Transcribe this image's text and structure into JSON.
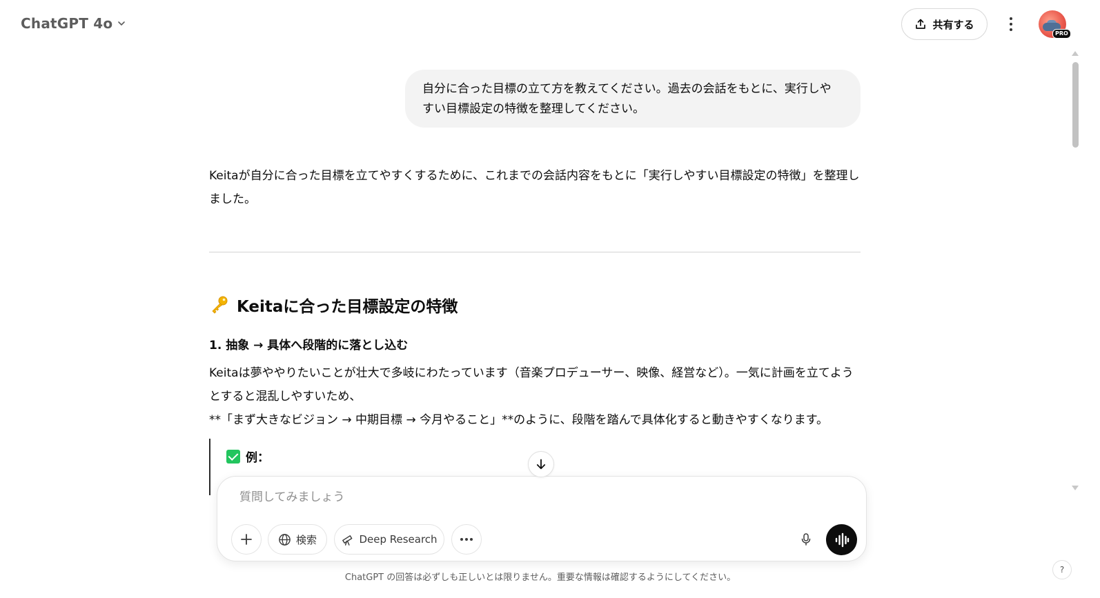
{
  "header": {
    "model_name": "ChatGPT 4o",
    "share_label": "共有する",
    "avatar_badge": "PRO"
  },
  "conversation": {
    "user_message": "自分に合った目標の立て方を教えてください。過去の会話をもとに、実行しやすい目標設定の特徴を整理してください。",
    "assistant": {
      "intro": "Keitaが自分に合った目標を立てやすくするために、これまでの会話内容をもとに「実行しやすい目標設定の特徴」を整理しました。",
      "section_title": "Keitaに合った目標設定の特徴",
      "section_icon": "key-icon",
      "item1_heading": "1. 抽象 → 具体へ段階的に落とし込む",
      "item1_para_line1": "Keitaは夢ややりたいことが壮大で多岐にわたっています（音楽プロデューサー、映像、経営など）。一気に計画を立てようとすると混乱しやすいため、",
      "item1_para_line2": "**「まず大きなビジョン → 中期目標 → 今月やること」**のように、段階を踏んで具体化すると動きやすくなります。",
      "example_label": "例："
    }
  },
  "composer": {
    "placeholder": "質問してみましょう",
    "search_label": "検索",
    "deep_research_label": "Deep Research"
  },
  "footer": {
    "disclaimer": "ChatGPT の回答は必ずしも正しいとは限りません。重要な情報は確認するようにしてください。",
    "help_label": "?"
  },
  "colors": {
    "accent_check": "#22c55e",
    "bubble_bg": "#f3f3f3",
    "voice_button": "#0d0d0d"
  }
}
